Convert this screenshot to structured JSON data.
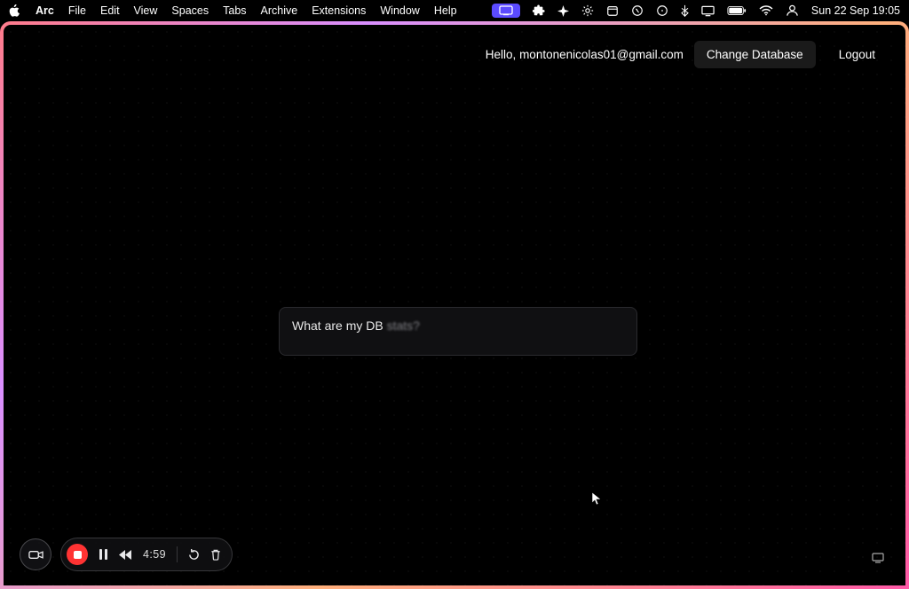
{
  "menubar": {
    "app_name": "Arc",
    "items": [
      "File",
      "Edit",
      "View",
      "Spaces",
      "Tabs",
      "Archive",
      "Extensions",
      "Window",
      "Help"
    ],
    "clock": "Sun 22 Sep  19:05"
  },
  "header": {
    "greeting_prefix": "Hello, ",
    "email": "montonenicolas01@gmail.com",
    "change_db": "Change Database",
    "logout": "Logout"
  },
  "chat": {
    "prefix": "What are my DB ",
    "suffix_blur": "stats?"
  },
  "recorder": {
    "time": "4:59"
  }
}
